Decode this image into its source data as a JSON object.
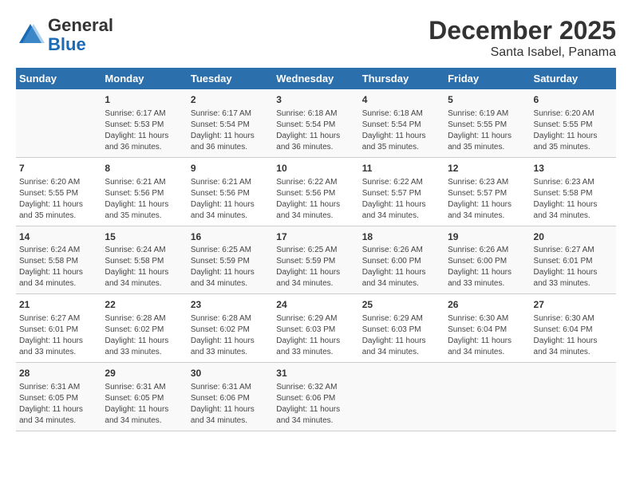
{
  "header": {
    "logo_general": "General",
    "logo_blue": "Blue",
    "title": "December 2025",
    "subtitle": "Santa Isabel, Panama"
  },
  "calendar": {
    "days_of_week": [
      "Sunday",
      "Monday",
      "Tuesday",
      "Wednesday",
      "Thursday",
      "Friday",
      "Saturday"
    ],
    "weeks": [
      [
        {
          "day": "",
          "sunrise": "",
          "sunset": "",
          "daylight": ""
        },
        {
          "day": "1",
          "sunrise": "Sunrise: 6:17 AM",
          "sunset": "Sunset: 5:53 PM",
          "daylight": "Daylight: 11 hours and 36 minutes."
        },
        {
          "day": "2",
          "sunrise": "Sunrise: 6:17 AM",
          "sunset": "Sunset: 5:54 PM",
          "daylight": "Daylight: 11 hours and 36 minutes."
        },
        {
          "day": "3",
          "sunrise": "Sunrise: 6:18 AM",
          "sunset": "Sunset: 5:54 PM",
          "daylight": "Daylight: 11 hours and 36 minutes."
        },
        {
          "day": "4",
          "sunrise": "Sunrise: 6:18 AM",
          "sunset": "Sunset: 5:54 PM",
          "daylight": "Daylight: 11 hours and 35 minutes."
        },
        {
          "day": "5",
          "sunrise": "Sunrise: 6:19 AM",
          "sunset": "Sunset: 5:55 PM",
          "daylight": "Daylight: 11 hours and 35 minutes."
        },
        {
          "day": "6",
          "sunrise": "Sunrise: 6:20 AM",
          "sunset": "Sunset: 5:55 PM",
          "daylight": "Daylight: 11 hours and 35 minutes."
        }
      ],
      [
        {
          "day": "7",
          "sunrise": "Sunrise: 6:20 AM",
          "sunset": "Sunset: 5:55 PM",
          "daylight": "Daylight: 11 hours and 35 minutes."
        },
        {
          "day": "8",
          "sunrise": "Sunrise: 6:21 AM",
          "sunset": "Sunset: 5:56 PM",
          "daylight": "Daylight: 11 hours and 35 minutes."
        },
        {
          "day": "9",
          "sunrise": "Sunrise: 6:21 AM",
          "sunset": "Sunset: 5:56 PM",
          "daylight": "Daylight: 11 hours and 34 minutes."
        },
        {
          "day": "10",
          "sunrise": "Sunrise: 6:22 AM",
          "sunset": "Sunset: 5:56 PM",
          "daylight": "Daylight: 11 hours and 34 minutes."
        },
        {
          "day": "11",
          "sunrise": "Sunrise: 6:22 AM",
          "sunset": "Sunset: 5:57 PM",
          "daylight": "Daylight: 11 hours and 34 minutes."
        },
        {
          "day": "12",
          "sunrise": "Sunrise: 6:23 AM",
          "sunset": "Sunset: 5:57 PM",
          "daylight": "Daylight: 11 hours and 34 minutes."
        },
        {
          "day": "13",
          "sunrise": "Sunrise: 6:23 AM",
          "sunset": "Sunset: 5:58 PM",
          "daylight": "Daylight: 11 hours and 34 minutes."
        }
      ],
      [
        {
          "day": "14",
          "sunrise": "Sunrise: 6:24 AM",
          "sunset": "Sunset: 5:58 PM",
          "daylight": "Daylight: 11 hours and 34 minutes."
        },
        {
          "day": "15",
          "sunrise": "Sunrise: 6:24 AM",
          "sunset": "Sunset: 5:58 PM",
          "daylight": "Daylight: 11 hours and 34 minutes."
        },
        {
          "day": "16",
          "sunrise": "Sunrise: 6:25 AM",
          "sunset": "Sunset: 5:59 PM",
          "daylight": "Daylight: 11 hours and 34 minutes."
        },
        {
          "day": "17",
          "sunrise": "Sunrise: 6:25 AM",
          "sunset": "Sunset: 5:59 PM",
          "daylight": "Daylight: 11 hours and 34 minutes."
        },
        {
          "day": "18",
          "sunrise": "Sunrise: 6:26 AM",
          "sunset": "Sunset: 6:00 PM",
          "daylight": "Daylight: 11 hours and 34 minutes."
        },
        {
          "day": "19",
          "sunrise": "Sunrise: 6:26 AM",
          "sunset": "Sunset: 6:00 PM",
          "daylight": "Daylight: 11 hours and 33 minutes."
        },
        {
          "day": "20",
          "sunrise": "Sunrise: 6:27 AM",
          "sunset": "Sunset: 6:01 PM",
          "daylight": "Daylight: 11 hours and 33 minutes."
        }
      ],
      [
        {
          "day": "21",
          "sunrise": "Sunrise: 6:27 AM",
          "sunset": "Sunset: 6:01 PM",
          "daylight": "Daylight: 11 hours and 33 minutes."
        },
        {
          "day": "22",
          "sunrise": "Sunrise: 6:28 AM",
          "sunset": "Sunset: 6:02 PM",
          "daylight": "Daylight: 11 hours and 33 minutes."
        },
        {
          "day": "23",
          "sunrise": "Sunrise: 6:28 AM",
          "sunset": "Sunset: 6:02 PM",
          "daylight": "Daylight: 11 hours and 33 minutes."
        },
        {
          "day": "24",
          "sunrise": "Sunrise: 6:29 AM",
          "sunset": "Sunset: 6:03 PM",
          "daylight": "Daylight: 11 hours and 33 minutes."
        },
        {
          "day": "25",
          "sunrise": "Sunrise: 6:29 AM",
          "sunset": "Sunset: 6:03 PM",
          "daylight": "Daylight: 11 hours and 34 minutes."
        },
        {
          "day": "26",
          "sunrise": "Sunrise: 6:30 AM",
          "sunset": "Sunset: 6:04 PM",
          "daylight": "Daylight: 11 hours and 34 minutes."
        },
        {
          "day": "27",
          "sunrise": "Sunrise: 6:30 AM",
          "sunset": "Sunset: 6:04 PM",
          "daylight": "Daylight: 11 hours and 34 minutes."
        }
      ],
      [
        {
          "day": "28",
          "sunrise": "Sunrise: 6:31 AM",
          "sunset": "Sunset: 6:05 PM",
          "daylight": "Daylight: 11 hours and 34 minutes."
        },
        {
          "day": "29",
          "sunrise": "Sunrise: 6:31 AM",
          "sunset": "Sunset: 6:05 PM",
          "daylight": "Daylight: 11 hours and 34 minutes."
        },
        {
          "day": "30",
          "sunrise": "Sunrise: 6:31 AM",
          "sunset": "Sunset: 6:06 PM",
          "daylight": "Daylight: 11 hours and 34 minutes."
        },
        {
          "day": "31",
          "sunrise": "Sunrise: 6:32 AM",
          "sunset": "Sunset: 6:06 PM",
          "daylight": "Daylight: 11 hours and 34 minutes."
        },
        {
          "day": "",
          "sunrise": "",
          "sunset": "",
          "daylight": ""
        },
        {
          "day": "",
          "sunrise": "",
          "sunset": "",
          "daylight": ""
        },
        {
          "day": "",
          "sunrise": "",
          "sunset": "",
          "daylight": ""
        }
      ]
    ]
  }
}
